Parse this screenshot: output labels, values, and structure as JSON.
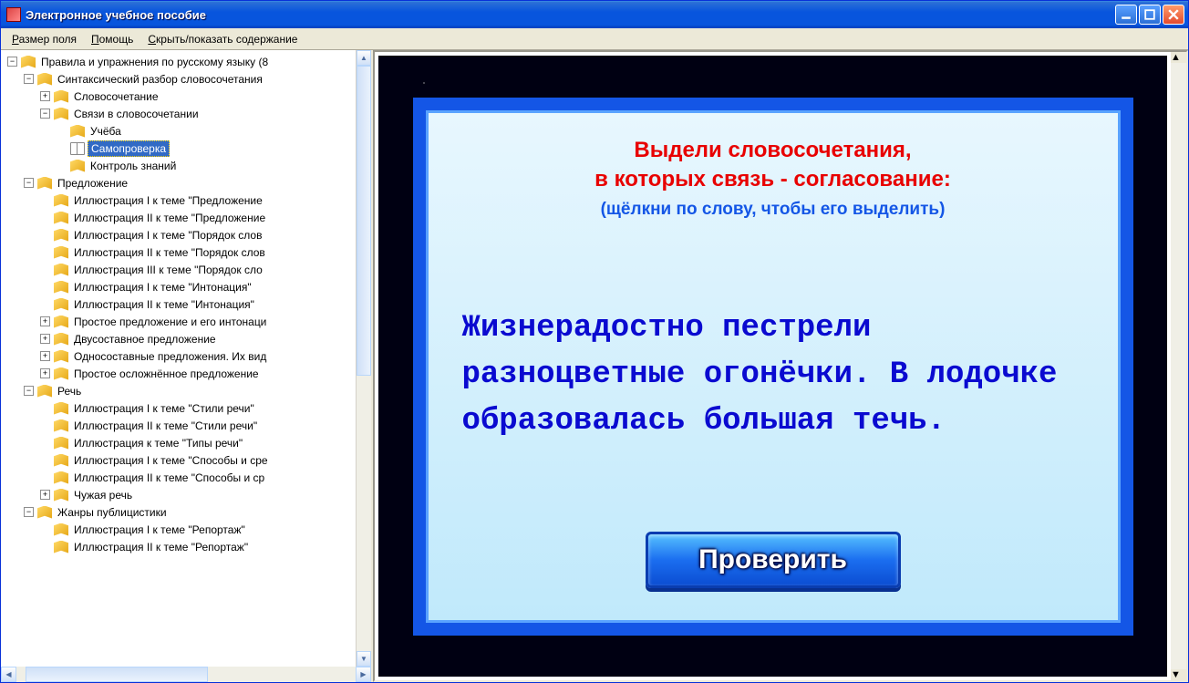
{
  "window": {
    "title": "Электронное учебное пособие"
  },
  "menubar": {
    "items": [
      {
        "label": "Размер поля",
        "u": "Р",
        "rest": "азмер поля"
      },
      {
        "label": "Помощь",
        "u": "П",
        "rest": "омощь"
      },
      {
        "label": "Скрыть/показать содержание",
        "u": "С",
        "rest": "крыть/показать содержание"
      }
    ]
  },
  "tree": [
    {
      "depth": 0,
      "exp": "-",
      "icon": "book",
      "label": "Правила и упражнения по русскому языку (8"
    },
    {
      "depth": 1,
      "exp": "-",
      "icon": "book",
      "label": "Синтаксический разбор словосочетания"
    },
    {
      "depth": 2,
      "exp": "+",
      "icon": "book",
      "label": "Словосочетание"
    },
    {
      "depth": 2,
      "exp": "-",
      "icon": "book",
      "label": "Связи в словосочетании"
    },
    {
      "depth": 3,
      "exp": "",
      "icon": "book",
      "label": "Учёба"
    },
    {
      "depth": 3,
      "exp": "",
      "icon": "open",
      "label": "Самопроверка",
      "selected": true
    },
    {
      "depth": 3,
      "exp": "",
      "icon": "book",
      "label": "Контроль знаний"
    },
    {
      "depth": 1,
      "exp": "-",
      "icon": "book",
      "label": "Предложение"
    },
    {
      "depth": 2,
      "exp": "",
      "icon": "book",
      "label": "Иллюстрация I к теме \"Предложение"
    },
    {
      "depth": 2,
      "exp": "",
      "icon": "book",
      "label": "Иллюстрация II к теме \"Предложение"
    },
    {
      "depth": 2,
      "exp": "",
      "icon": "book",
      "label": "Иллюстрация I к теме \"Порядок слов"
    },
    {
      "depth": 2,
      "exp": "",
      "icon": "book",
      "label": "Иллюстрация II к теме \"Порядок слов"
    },
    {
      "depth": 2,
      "exp": "",
      "icon": "book",
      "label": "Иллюстрация III к теме \"Порядок сло"
    },
    {
      "depth": 2,
      "exp": "",
      "icon": "book",
      "label": "Иллюстрация I к теме \"Интонация\""
    },
    {
      "depth": 2,
      "exp": "",
      "icon": "book",
      "label": "Иллюстрация II к теме \"Интонация\""
    },
    {
      "depth": 2,
      "exp": "+",
      "icon": "book",
      "label": "Простое предложение и его интонаци"
    },
    {
      "depth": 2,
      "exp": "+",
      "icon": "book",
      "label": "Двусоставное предложение"
    },
    {
      "depth": 2,
      "exp": "+",
      "icon": "book",
      "label": "Односоставные предложения. Их вид"
    },
    {
      "depth": 2,
      "exp": "+",
      "icon": "book",
      "label": "Простое осложнённое предложение"
    },
    {
      "depth": 1,
      "exp": "-",
      "icon": "book",
      "label": "Речь"
    },
    {
      "depth": 2,
      "exp": "",
      "icon": "book",
      "label": "Иллюстрация I к теме \"Стили речи\""
    },
    {
      "depth": 2,
      "exp": "",
      "icon": "book",
      "label": "Иллюстрация II к теме \"Стили речи\""
    },
    {
      "depth": 2,
      "exp": "",
      "icon": "book",
      "label": "Иллюстрация к теме \"Типы речи\""
    },
    {
      "depth": 2,
      "exp": "",
      "icon": "book",
      "label": "Иллюстрация I к теме \"Способы и сре"
    },
    {
      "depth": 2,
      "exp": "",
      "icon": "book",
      "label": "Иллюстрация II к теме \"Способы и ср"
    },
    {
      "depth": 2,
      "exp": "+",
      "icon": "book",
      "label": "Чужая речь"
    },
    {
      "depth": 1,
      "exp": "-",
      "icon": "book",
      "label": "Жанры публицистики"
    },
    {
      "depth": 2,
      "exp": "",
      "icon": "book",
      "label": "Иллюстрация I к теме \"Репортаж\""
    },
    {
      "depth": 2,
      "exp": "",
      "icon": "book",
      "label": "Иллюстрация II к теме \"Репортаж\""
    }
  ],
  "lesson": {
    "headline1": "Выдели словосочетания,",
    "headline2": "в которых связь - согласование:",
    "hint": "(щёлкни по слову, чтобы его выделить)",
    "sentence": "Жизнерадостно пестрели разноцветные огонёчки. В лодочке образовалась большая течь.",
    "check_label": "Проверить"
  }
}
